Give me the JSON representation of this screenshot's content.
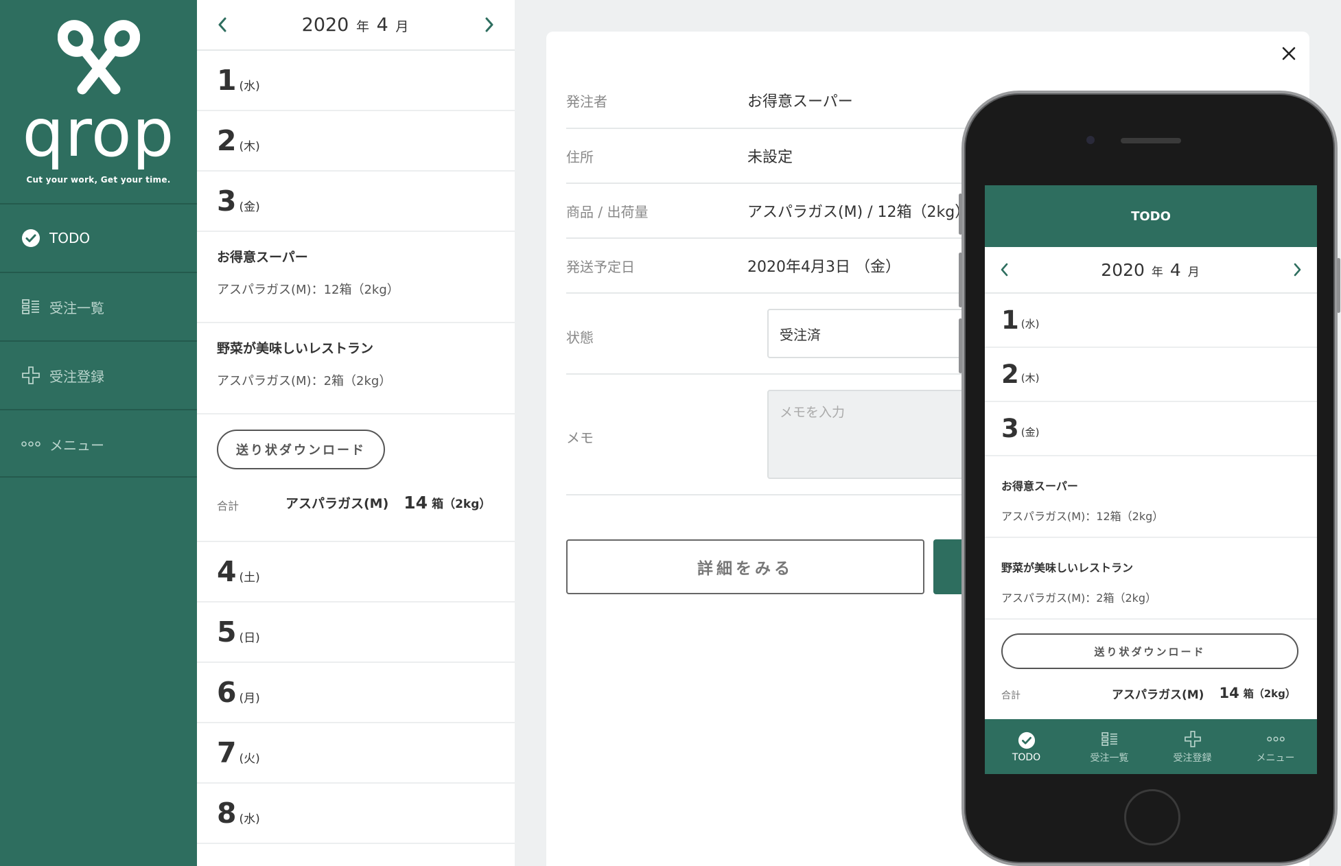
{
  "app": {
    "brand": "qrop",
    "tagline": "Cut your work, Get your time."
  },
  "sidebar": {
    "items": [
      {
        "label": "TODO",
        "icon": "check-circle-icon",
        "active": true
      },
      {
        "label": "受注一覧",
        "icon": "list-icon",
        "active": false
      },
      {
        "label": "受注登録",
        "icon": "plus-icon",
        "active": false
      },
      {
        "label": "メニュー",
        "icon": "more-icon",
        "active": false
      }
    ]
  },
  "calendar": {
    "year": "2020",
    "year_unit": "年",
    "month": "4",
    "month_unit": "月",
    "days": [
      {
        "num": "1",
        "wd": "(水)"
      },
      {
        "num": "2",
        "wd": "(木)"
      },
      {
        "num": "3",
        "wd": "(金)"
      },
      {
        "num": "4",
        "wd": "(土)"
      },
      {
        "num": "5",
        "wd": "(日)"
      },
      {
        "num": "6",
        "wd": "(月)"
      },
      {
        "num": "7",
        "wd": "(火)"
      },
      {
        "num": "8",
        "wd": "(水)"
      }
    ],
    "orders": [
      {
        "customer": "お得意スーパー",
        "item": "アスパラガス(M)：12箱（2kg）"
      },
      {
        "customer": "野菜が美味しいレストラン",
        "item": "アスパラガス(M)：2箱（2kg）"
      }
    ],
    "download_label": "送り状ダウンロード",
    "total": {
      "label": "合計",
      "product": "アスパラガス(M)",
      "qty": "14",
      "unit": "箱（2kg）"
    }
  },
  "detail": {
    "fields": [
      {
        "label": "発注者",
        "value": "お得意スーパー"
      },
      {
        "label": "住所",
        "value": "未設定"
      },
      {
        "label": "商品 / 出荷量",
        "value": "アスパラガス(M) / 12箱（2kg）"
      },
      {
        "label": "発送予定日",
        "value": "2020年4月3日 （金）"
      }
    ],
    "status_label": "状態",
    "status_value": "受注済",
    "memo_label": "メモ",
    "memo_placeholder": "メモを入力",
    "detail_button": "詳細をみる"
  },
  "phone": {
    "header": "TODO",
    "days": [
      {
        "num": "1",
        "wd": "(水)"
      },
      {
        "num": "2",
        "wd": "(木)"
      },
      {
        "num": "3",
        "wd": "(金)"
      }
    ],
    "tabs": [
      {
        "label": "TODO",
        "icon": "check-circle-icon",
        "active": true
      },
      {
        "label": "受注一覧",
        "icon": "list-icon",
        "active": false
      },
      {
        "label": "受注登録",
        "icon": "plus-icon",
        "active": false
      },
      {
        "label": "メニュー",
        "icon": "more-icon",
        "active": false
      }
    ]
  },
  "colors": {
    "brand_green": "#2e6e5f",
    "sidebar_divider": "#245a4d",
    "background": "#eef0f1"
  }
}
